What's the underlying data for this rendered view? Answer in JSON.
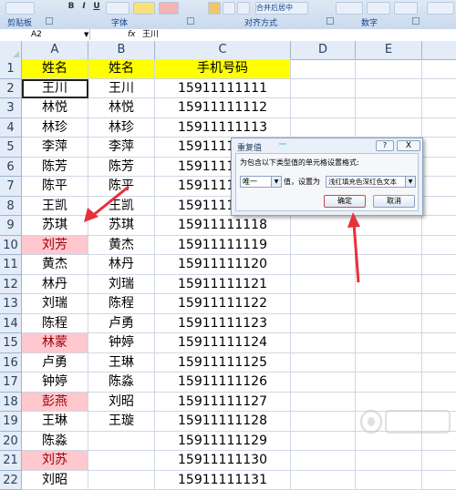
{
  "ribbon": {
    "groups": [
      "剪贴板",
      "字体",
      "对齐方式",
      "数字"
    ],
    "merge_label": "合并后居中",
    "font_buttons": [
      "B",
      "I",
      "U"
    ]
  },
  "formula_bar": {
    "name_box": "A2",
    "fx_label": "fx",
    "value": "王川"
  },
  "columns": [
    "A",
    "B",
    "C",
    "D",
    "E"
  ],
  "rows": [
    {
      "n": "1",
      "a": "姓名",
      "b": "姓名",
      "c": "手机号码",
      "header": true
    },
    {
      "n": "2",
      "a": "王川",
      "b": "王川",
      "c": "15911111111"
    },
    {
      "n": "3",
      "a": "林悦",
      "b": "林悦",
      "c": "15911111112"
    },
    {
      "n": "4",
      "a": "林珍",
      "b": "林珍",
      "c": "15911111113"
    },
    {
      "n": "5",
      "a": "李萍",
      "b": "李萍",
      "c": "15911111114"
    },
    {
      "n": "6",
      "a": "陈芳",
      "b": "陈芳",
      "c": "15911111115"
    },
    {
      "n": "7",
      "a": "陈平",
      "b": "陈平",
      "c": "15911111116"
    },
    {
      "n": "8",
      "a": "王凯",
      "b": "王凯",
      "c": "15911111117"
    },
    {
      "n": "9",
      "a": "苏琪",
      "b": "苏琪",
      "c": "15911111118"
    },
    {
      "n": "10",
      "a": "刘芳",
      "b": "黄杰",
      "c": "15911111119",
      "dup": true
    },
    {
      "n": "11",
      "a": "黄杰",
      "b": "林丹",
      "c": "15911111120"
    },
    {
      "n": "12",
      "a": "林丹",
      "b": "刘瑞",
      "c": "15911111121"
    },
    {
      "n": "13",
      "a": "刘瑞",
      "b": "陈程",
      "c": "15911111122"
    },
    {
      "n": "14",
      "a": "陈程",
      "b": "卢勇",
      "c": "15911111123"
    },
    {
      "n": "15",
      "a": "林蒙",
      "b": "钟婷",
      "c": "15911111124",
      "dup": true
    },
    {
      "n": "16",
      "a": "卢勇",
      "b": "王琳",
      "c": "15911111125"
    },
    {
      "n": "17",
      "a": "钟婷",
      "b": "陈淼",
      "c": "15911111126"
    },
    {
      "n": "18",
      "a": "彭燕",
      "b": "刘昭",
      "c": "15911111127",
      "dup": true
    },
    {
      "n": "19",
      "a": "王琳",
      "b": "王璇",
      "c": "15911111128"
    },
    {
      "n": "20",
      "a": "陈淼",
      "b": "",
      "c": "15911111129"
    },
    {
      "n": "21",
      "a": "刘苏",
      "b": "",
      "c": "15911111130",
      "dup": true
    },
    {
      "n": "22",
      "a": "刘昭",
      "b": "",
      "c": "15911111131"
    }
  ],
  "dialog": {
    "title": "重复值",
    "help": "?",
    "close": "X",
    "description": "为包含以下类型值的单元格设置格式:",
    "type_value": "唯一",
    "middle_text": "值，设置为",
    "format_value": "浅红填充色深红色文本",
    "ok": "确定",
    "cancel": "取消"
  },
  "colors": {
    "header_fill": "#ffff00",
    "dup_fill": "#ffc7ce",
    "dup_text": "#9c0006",
    "arrow": "#e8303a"
  }
}
